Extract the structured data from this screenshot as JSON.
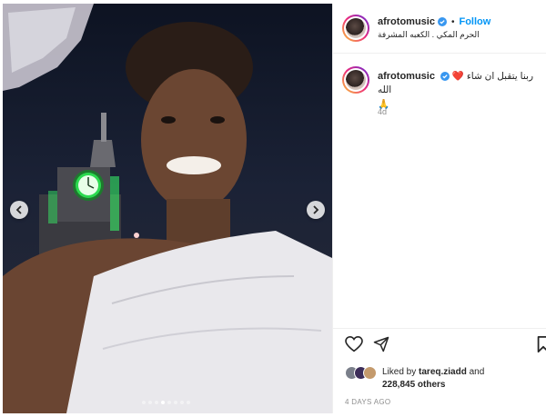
{
  "post": {
    "username": "afrotomusic",
    "follow_label": "Follow",
    "separator": "•",
    "location": "الحرم المكي . الكعبه المشرفة",
    "caption": "ربنا يتقبل ان شاء الله",
    "caption_emojis_before": "❤️",
    "caption_emojis_after": "🙏",
    "caption_age": "4d",
    "liked_by_prefix": "Liked by",
    "liked_by_user": "tareq.ziadd",
    "liked_by_and": "and",
    "others_count": "228,845 others",
    "timestamp": "4 DAYS AGO"
  },
  "carousel": {
    "dot_count": 8,
    "active_index": 3
  },
  "colors": {
    "follow_blue": "#0095f6",
    "verified_blue": "#3897f0",
    "clock_green": "#39ff6a"
  },
  "icons": {
    "like": "heart-icon",
    "share": "paper-plane-icon",
    "save": "bookmark-icon",
    "prev": "chevron-left-icon",
    "next": "chevron-right-icon",
    "verified": "verified-badge-icon"
  }
}
